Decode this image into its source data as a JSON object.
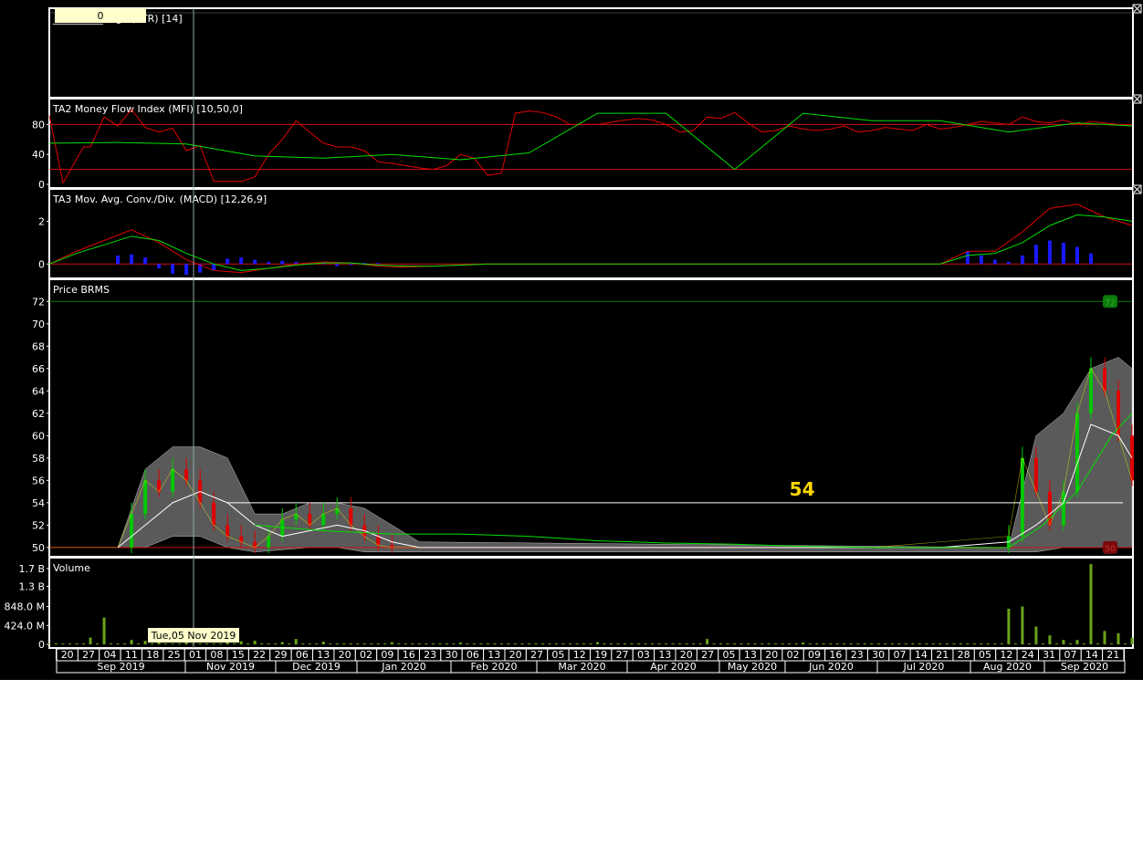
{
  "cursor_readout": "0",
  "cursor_date_label": "Tue,05 Nov 2019",
  "price_marker_label": "54",
  "colors": {
    "background": "#000000",
    "frame": "#ffffff",
    "up": "#00c800",
    "down": "#e00000",
    "signal": "#00e000",
    "histogram": "#1a1aff",
    "grid": "#d01010",
    "volume": "#6aa318",
    "band": "#5a5a5a",
    "highlight": "#ffff00"
  },
  "chart_data": [
    {
      "type": "line",
      "title": "TA1 Average True Range (ATR) [14]",
      "title_visible": "__________ange (ATR) [14]",
      "series": []
    },
    {
      "type": "line",
      "title": "TA2 Money Flow Index (MFI) [10,50,0]",
      "y_ticks": [
        "0",
        "40",
        "80"
      ],
      "ylim": [
        0,
        100
      ],
      "reference_lines": [
        20,
        80
      ],
      "series": [
        {
          "name": "MFI",
          "color": "#e00000",
          "x": [
            0,
            2,
            5,
            6,
            8,
            10,
            12,
            14,
            16,
            18,
            20,
            22,
            24,
            26,
            28,
            30,
            32,
            34,
            36,
            38,
            40,
            42,
            44,
            46,
            48,
            50,
            52,
            54,
            56,
            58,
            60,
            62,
            64,
            66,
            68,
            70,
            72,
            74,
            76,
            80,
            84,
            86,
            88,
            90,
            92,
            94,
            96,
            98,
            100,
            102,
            104,
            106,
            108,
            110,
            112,
            114,
            116,
            118,
            120,
            122,
            124,
            126,
            128,
            130,
            132,
            134,
            136,
            138,
            140,
            142,
            144,
            146,
            148,
            150,
            152,
            154,
            156,
            158
          ],
          "y": [
            92,
            2,
            50,
            50,
            90,
            78,
            100,
            76,
            70,
            75,
            45,
            52,
            4,
            4,
            4,
            10,
            40,
            60,
            85,
            70,
            55,
            50,
            50,
            45,
            30,
            28,
            25,
            22,
            20,
            25,
            40,
            35,
            12,
            15,
            95,
            98,
            96,
            90,
            80,
            80,
            86,
            88,
            86,
            80,
            70,
            72,
            90,
            88,
            96,
            82,
            70,
            72,
            78,
            74,
            72,
            74,
            78,
            70,
            72,
            76,
            74,
            72,
            80,
            74,
            76,
            80,
            84,
            82,
            80,
            90,
            84,
            82,
            86,
            80,
            84,
            82,
            80,
            78
          ]
        },
        {
          "name": "Signal",
          "color": "#00e000",
          "x": [
            0,
            10,
            20,
            30,
            40,
            50,
            60,
            70,
            80,
            90,
            100,
            110,
            120,
            130,
            140,
            150,
            158
          ],
          "y": [
            55,
            56,
            54,
            38,
            35,
            40,
            33,
            42,
            95,
            95,
            20,
            95,
            85,
            85,
            70,
            82,
            78
          ]
        }
      ]
    },
    {
      "type": "line",
      "title": "TA3 Mov. Avg. Conv./Div. (MACD) [12,26,9]",
      "y_ticks": [
        "0",
        "2"
      ],
      "ylim": [
        -0.5,
        3.0
      ],
      "series": [
        {
          "name": "MACD",
          "color": "#e00000",
          "x": [
            0,
            4,
            8,
            12,
            16,
            20,
            24,
            28,
            32,
            36,
            40,
            44,
            48,
            52,
            56,
            60,
            64,
            68,
            72,
            76,
            80,
            84,
            88,
            92,
            96,
            100,
            104,
            108,
            112,
            116,
            120,
            124,
            128,
            130,
            134,
            138,
            142,
            146,
            150,
            154,
            158
          ],
          "y": [
            0,
            0.6,
            1.1,
            1.6,
            1.0,
            0.2,
            -0.3,
            -0.4,
            -0.2,
            0,
            0.1,
            0.05,
            -0.1,
            -0.15,
            -0.1,
            -0.05,
            0,
            0.0,
            0,
            0,
            0,
            0,
            0,
            0,
            0,
            0,
            0,
            0,
            0,
            0,
            0,
            0,
            0,
            0,
            0.6,
            0.6,
            1.5,
            2.6,
            2.8,
            2.2,
            1.8
          ]
        },
        {
          "name": "Signal",
          "color": "#00e000",
          "x": [
            0,
            4,
            8,
            12,
            16,
            20,
            24,
            28,
            32,
            36,
            40,
            44,
            48,
            52,
            56,
            60,
            64,
            68,
            72,
            76,
            80,
            84,
            88,
            92,
            96,
            100,
            104,
            108,
            112,
            116,
            120,
            124,
            128,
            130,
            134,
            138,
            142,
            146,
            150,
            154,
            158
          ],
          "y": [
            0,
            0.5,
            0.9,
            1.3,
            1.1,
            0.5,
            0,
            -0.3,
            -0.2,
            -0.05,
            0.05,
            0.05,
            -0.05,
            -0.1,
            -0.1,
            -0.05,
            0,
            0,
            0,
            0,
            0,
            0,
            0,
            0,
            0,
            0,
            0,
            0,
            0,
            0,
            0,
            0,
            0,
            0,
            0.4,
            0.5,
            1.0,
            1.8,
            2.3,
            2.2,
            2.0
          ]
        },
        {
          "name": "Histogram",
          "color": "#1a1aff",
          "x": [
            10,
            12,
            14,
            16,
            18,
            20,
            22,
            24,
            26,
            28,
            30,
            32,
            34,
            36,
            38,
            40,
            42,
            44,
            46,
            48,
            134,
            136,
            138,
            140,
            142,
            144,
            146,
            148,
            150,
            152
          ],
          "y": [
            0.4,
            0.45,
            0.3,
            -0.2,
            -0.45,
            -0.5,
            -0.4,
            -0.3,
            0.25,
            0.3,
            0.2,
            0.1,
            0.15,
            0.1,
            0.05,
            0.1,
            -0.1,
            -0.05,
            0.05,
            0.05,
            0.6,
            0.4,
            0.2,
            0.1,
            0.4,
            0.9,
            1.1,
            1.0,
            0.8,
            0.5
          ]
        }
      ]
    },
    {
      "type": "line",
      "title": "Price BRMS",
      "y_ticks": [
        "50",
        "52",
        "54",
        "56",
        "58",
        "60",
        "62",
        "64",
        "66",
        "68",
        "70",
        "72"
      ],
      "ylim": [
        49.5,
        73
      ],
      "reference_lines": [
        50,
        72,
        54
      ],
      "last_high_label": "72",
      "last_low_label": "50",
      "series": [
        {
          "name": "Close",
          "color": "#ffff00",
          "x": [
            0,
            4,
            8,
            10,
            12,
            14,
            16,
            18,
            20,
            22,
            24,
            26,
            28,
            30,
            32,
            34,
            36,
            38,
            40,
            42,
            44,
            46,
            48,
            50,
            52,
            54,
            60,
            70,
            80,
            90,
            100,
            110,
            120,
            140,
            142,
            144,
            146,
            148,
            150,
            152,
            154,
            156,
            158
          ],
          "y": [
            50,
            50,
            50,
            50,
            53,
            56,
            55,
            57,
            56,
            54,
            52,
            51,
            50.5,
            50,
            51,
            52.5,
            53,
            52,
            53,
            53.5,
            52,
            51,
            50.2,
            50,
            50,
            50,
            50,
            50,
            50,
            50,
            50,
            50,
            50,
            51,
            58,
            55,
            52,
            55,
            62,
            66,
            64,
            60,
            56
          ]
        },
        {
          "name": "Mid band",
          "color": "#ffffff",
          "x": [
            10,
            14,
            18,
            22,
            26,
            30,
            34,
            38,
            42,
            46,
            50,
            54,
            60,
            70,
            80,
            90,
            100,
            110,
            120,
            130,
            140,
            144,
            148,
            152,
            156,
            158
          ],
          "y": [
            50,
            52,
            54,
            55,
            54,
            52,
            51,
            51.5,
            52,
            51.5,
            50.5,
            50,
            50,
            50,
            50,
            50,
            50,
            50,
            50,
            50,
            50.5,
            52,
            54,
            61,
            60,
            58
          ]
        },
        {
          "name": "MA",
          "color": "#00e000",
          "x": [
            30,
            40,
            50,
            60,
            70,
            80,
            90,
            100,
            110,
            120,
            130,
            140,
            145,
            150,
            155,
            158
          ],
          "y": [
            52,
            51.5,
            51.2,
            51.2,
            51,
            50.6,
            50.4,
            50.3,
            50.1,
            50,
            50,
            50,
            52,
            55,
            60,
            62
          ]
        }
      ],
      "band": {
        "x": [
          10,
          14,
          18,
          22,
          26,
          30,
          34,
          38,
          42,
          46,
          50,
          54,
          140,
          144,
          148,
          152,
          156,
          158
        ],
        "upper": [
          50,
          57,
          59,
          59,
          58,
          53,
          53,
          54,
          54,
          53.5,
          52,
          50.5,
          50,
          60,
          62,
          66,
          67,
          66
        ],
        "lower": [
          50,
          50,
          51,
          51,
          50,
          49.6,
          49.8,
          50,
          50,
          49.6,
          49.6,
          49.6,
          49.6,
          49.6,
          50,
          50,
          50,
          50
        ]
      }
    },
    {
      "type": "bar",
      "title": "Volume",
      "y_ticks": [
        "0",
        "424.0 M",
        "848.0 M",
        "1.3 B",
        "1.7 B"
      ],
      "ylim": [
        0,
        1.7
      ],
      "spikes": {
        "x": [
          6,
          8,
          12,
          14,
          16,
          20,
          26,
          28,
          30,
          34,
          36,
          40,
          50,
          60,
          80,
          96,
          110,
          140,
          142,
          144,
          146,
          148,
          150,
          152,
          154,
          156,
          158
        ],
        "y": [
          0.15,
          0.6,
          0.1,
          0.08,
          0.07,
          0.05,
          0.12,
          0.07,
          0.08,
          0.05,
          0.12,
          0.06,
          0.05,
          0.04,
          0.05,
          0.12,
          0.04,
          0.8,
          0.85,
          0.4,
          0.2,
          0.1,
          0.1,
          1.8,
          0.3,
          0.25,
          0.15
        ]
      }
    }
  ],
  "x_axis": {
    "days": [
      "20",
      "27",
      "04",
      "11",
      "18",
      "25",
      "01",
      "08",
      "15",
      "22",
      "29",
      "06",
      "13",
      "20",
      "02",
      "09",
      "16",
      "23",
      "30",
      "06",
      "13",
      "20",
      "27",
      "05",
      "12",
      "19",
      "27",
      "03",
      "13",
      "20",
      "27",
      "05",
      "13",
      "20",
      "02",
      "09",
      "16",
      "23",
      "30",
      "07",
      "14",
      "21",
      "28",
      "05",
      "12",
      "24",
      "31",
      "07",
      "14",
      "21"
    ],
    "months": [
      "Sep 2019",
      "Nov 2019",
      "Dec 2019",
      "Jan 2020",
      "Feb 2020",
      "Mar 2020",
      "Apr 2020",
      "May 2020",
      "Jun 2020",
      "Jul 2020",
      "Aug 2020",
      "Sep 2020"
    ]
  }
}
